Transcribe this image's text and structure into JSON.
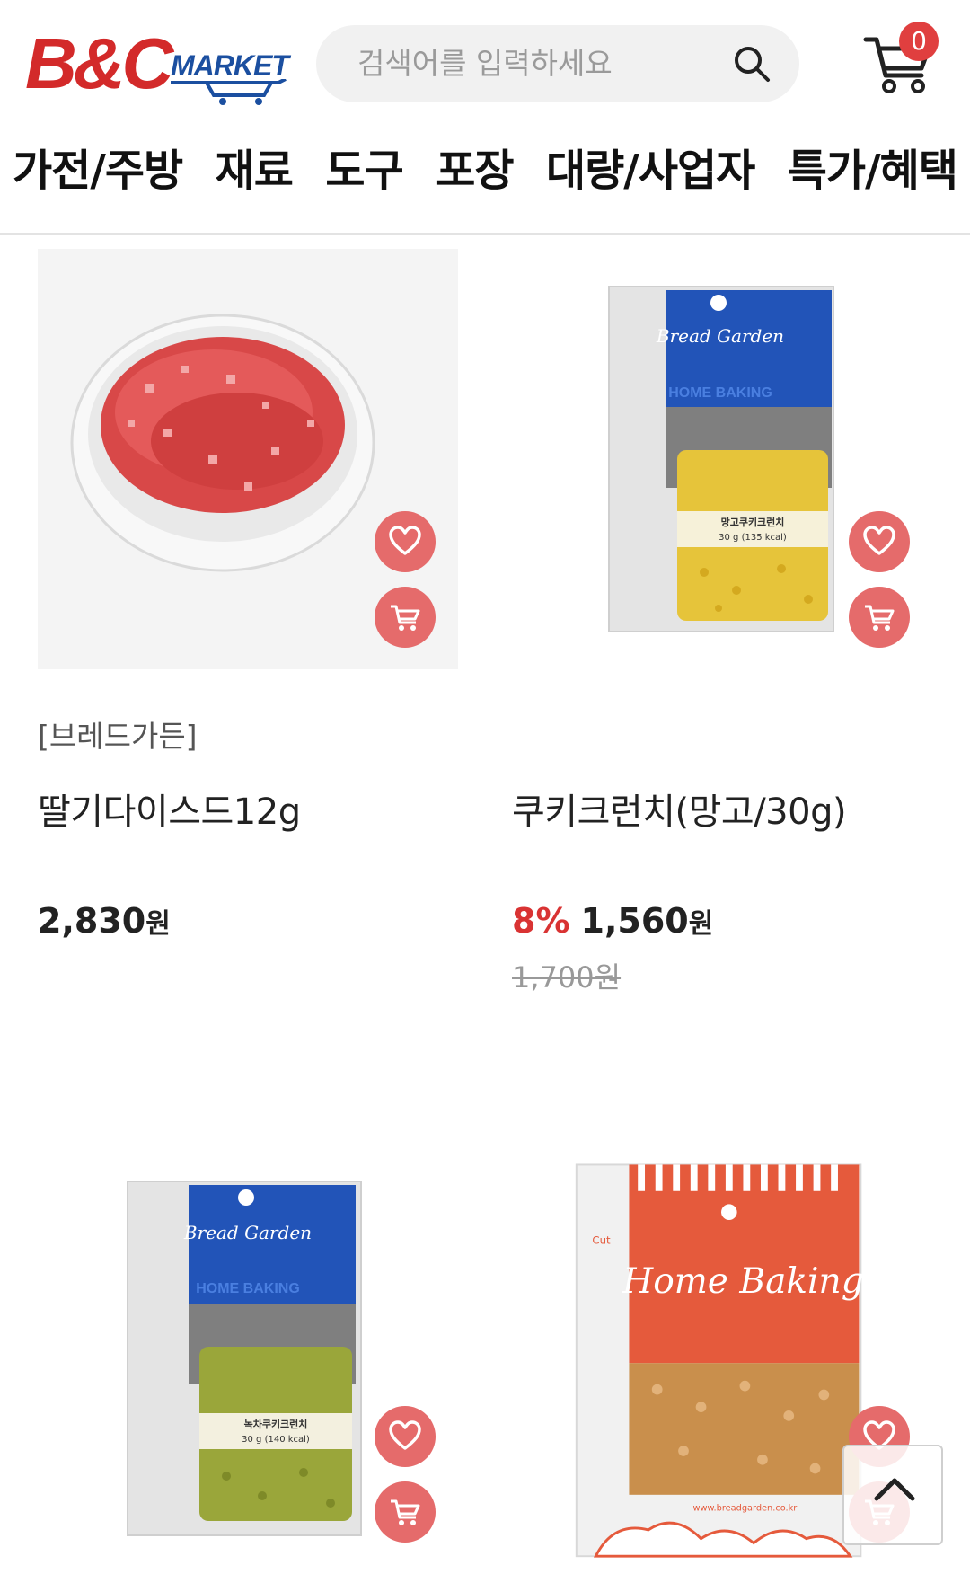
{
  "header": {
    "logo_text": "B&C",
    "logo_sub": "MARKET",
    "search_placeholder": "검색어를 입력하세요",
    "cart_count": "0"
  },
  "nav": [
    "가전/주방",
    "재료",
    "도구",
    "포장",
    "대량/사업자",
    "특가/혜택"
  ],
  "products": [
    {
      "brand": "[브레드가든]",
      "name": "딸기다이스드12g",
      "price": "2,830",
      "won": "원",
      "discount": "",
      "original_price": ""
    },
    {
      "brand": "",
      "name": "쿠키크런치(망고/30g)",
      "price": "1,560",
      "won": "원",
      "discount": "8%",
      "original_price": "1,700원"
    },
    {
      "brand": "",
      "name": "",
      "price": "",
      "won": "",
      "discount": "",
      "original_price": ""
    },
    {
      "brand": "",
      "name": "",
      "price": "",
      "won": "",
      "discount": "",
      "original_price": ""
    }
  ],
  "package_text": {
    "bread_garden": "Bread Garden",
    "home_baking": "HOME BAKING",
    "mango_label": "망고쿠키크런치",
    "mango_weight": "30 g (135 kcal)",
    "greentea_label": "녹차쿠키크런치",
    "greentea_weight": "30 g (140 kcal)",
    "home_baking_script": "Home Baking",
    "cut": "Cut",
    "website": "www.breadgarden.co.kr"
  },
  "colors": {
    "brand_red": "#d32a2a",
    "brand_blue": "#1b4fa0",
    "action_pink": "#e56b6b",
    "discount_red": "#d93333"
  }
}
